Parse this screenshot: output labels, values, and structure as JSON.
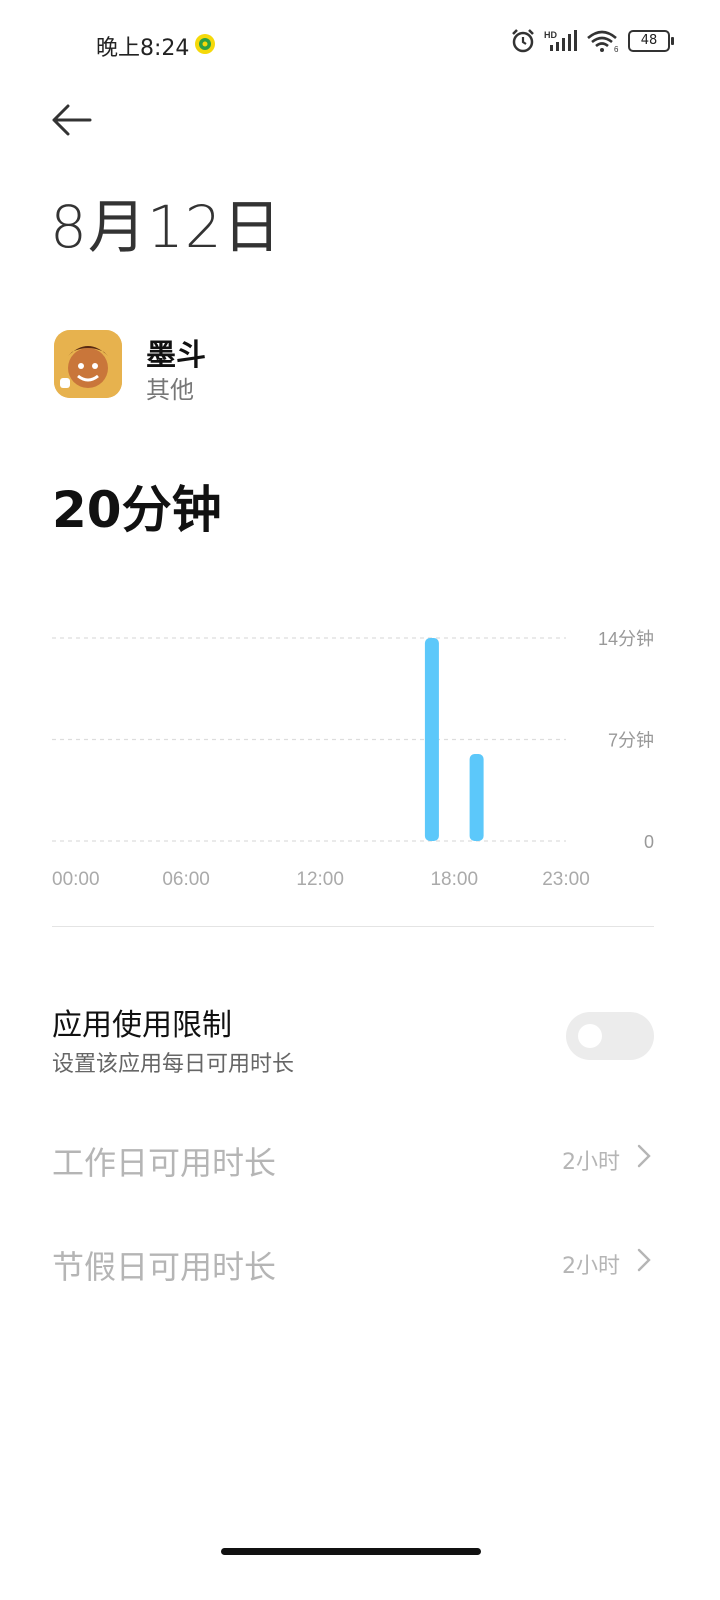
{
  "status_bar": {
    "time": "晚上8:24",
    "battery": "48",
    "network_label": "HD",
    "wifi_label": "6"
  },
  "header": {
    "date": "8月12日"
  },
  "app": {
    "name": "墨斗",
    "category": "其他"
  },
  "usage": {
    "total": "20分钟"
  },
  "chart_data": {
    "type": "bar",
    "categories": [
      "17:00",
      "19:00"
    ],
    "values": [
      14,
      6
    ],
    "y_tick_labels": [
      "14分钟",
      "7分钟",
      "0"
    ],
    "y_ticks": [
      14,
      7,
      0
    ],
    "x_tick_labels": [
      "00:00",
      "06:00",
      "12:00",
      "18:00",
      "23:00"
    ],
    "x_ticks": [
      0,
      6,
      12,
      18,
      23
    ],
    "ylim": [
      0,
      14
    ],
    "xlim": [
      0,
      23
    ],
    "grid": true,
    "bar_color": "#5cc8fa"
  },
  "limit": {
    "title": "应用使用限制",
    "subtitle": "设置该应用每日可用时长",
    "enabled": false
  },
  "rows": [
    {
      "label": "工作日可用时长",
      "value": "2小时"
    },
    {
      "label": "节假日可用时长",
      "value": "2小时"
    }
  ],
  "colors": {
    "accent": "#5cc8fa",
    "disabled_text": "#b5b5b5"
  }
}
